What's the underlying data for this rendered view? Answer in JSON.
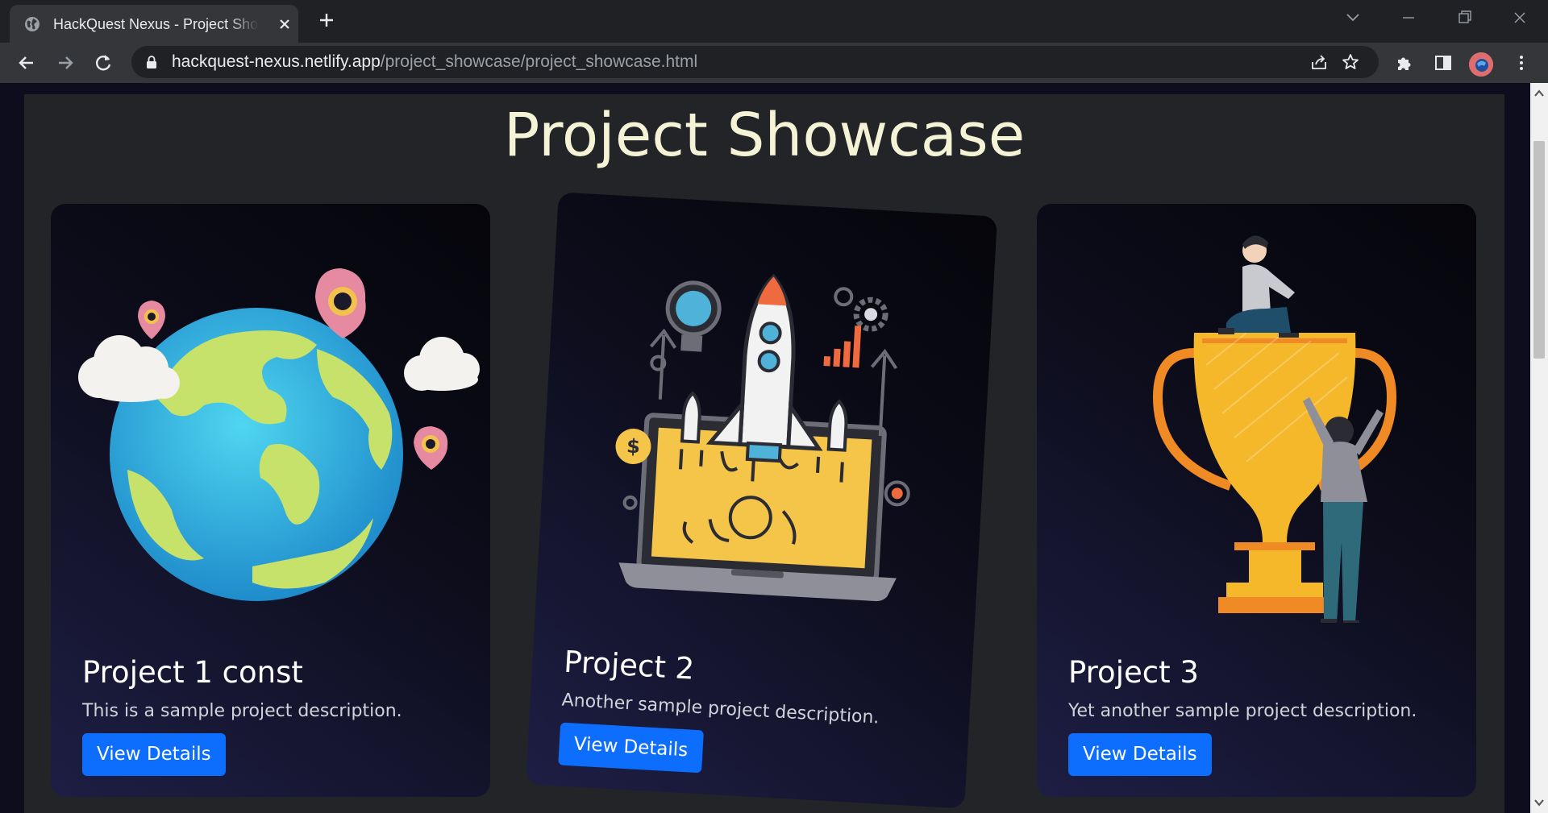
{
  "browser": {
    "tab_title": "HackQuest Nexus - Project Showcase",
    "url_host": "hackquest-nexus.netlify.app",
    "url_path": "/project_showcase/project_showcase.html"
  },
  "page": {
    "title": "Project Showcase",
    "projects": [
      {
        "title": "Project 1 const",
        "description": "This is a sample project description.",
        "button": "View Details",
        "image": "globe-with-location-pins"
      },
      {
        "title": "Project 2",
        "description": "Another sample project description.",
        "button": "View Details",
        "image": "rocket-launch-from-laptop"
      },
      {
        "title": "Project 3",
        "description": "Yet another sample project description.",
        "button": "View Details",
        "image": "trophy-with-people"
      }
    ]
  },
  "colors": {
    "accent": "#0d6efd",
    "title_color": "#f5f3d6",
    "panel_bg": "#222428"
  }
}
